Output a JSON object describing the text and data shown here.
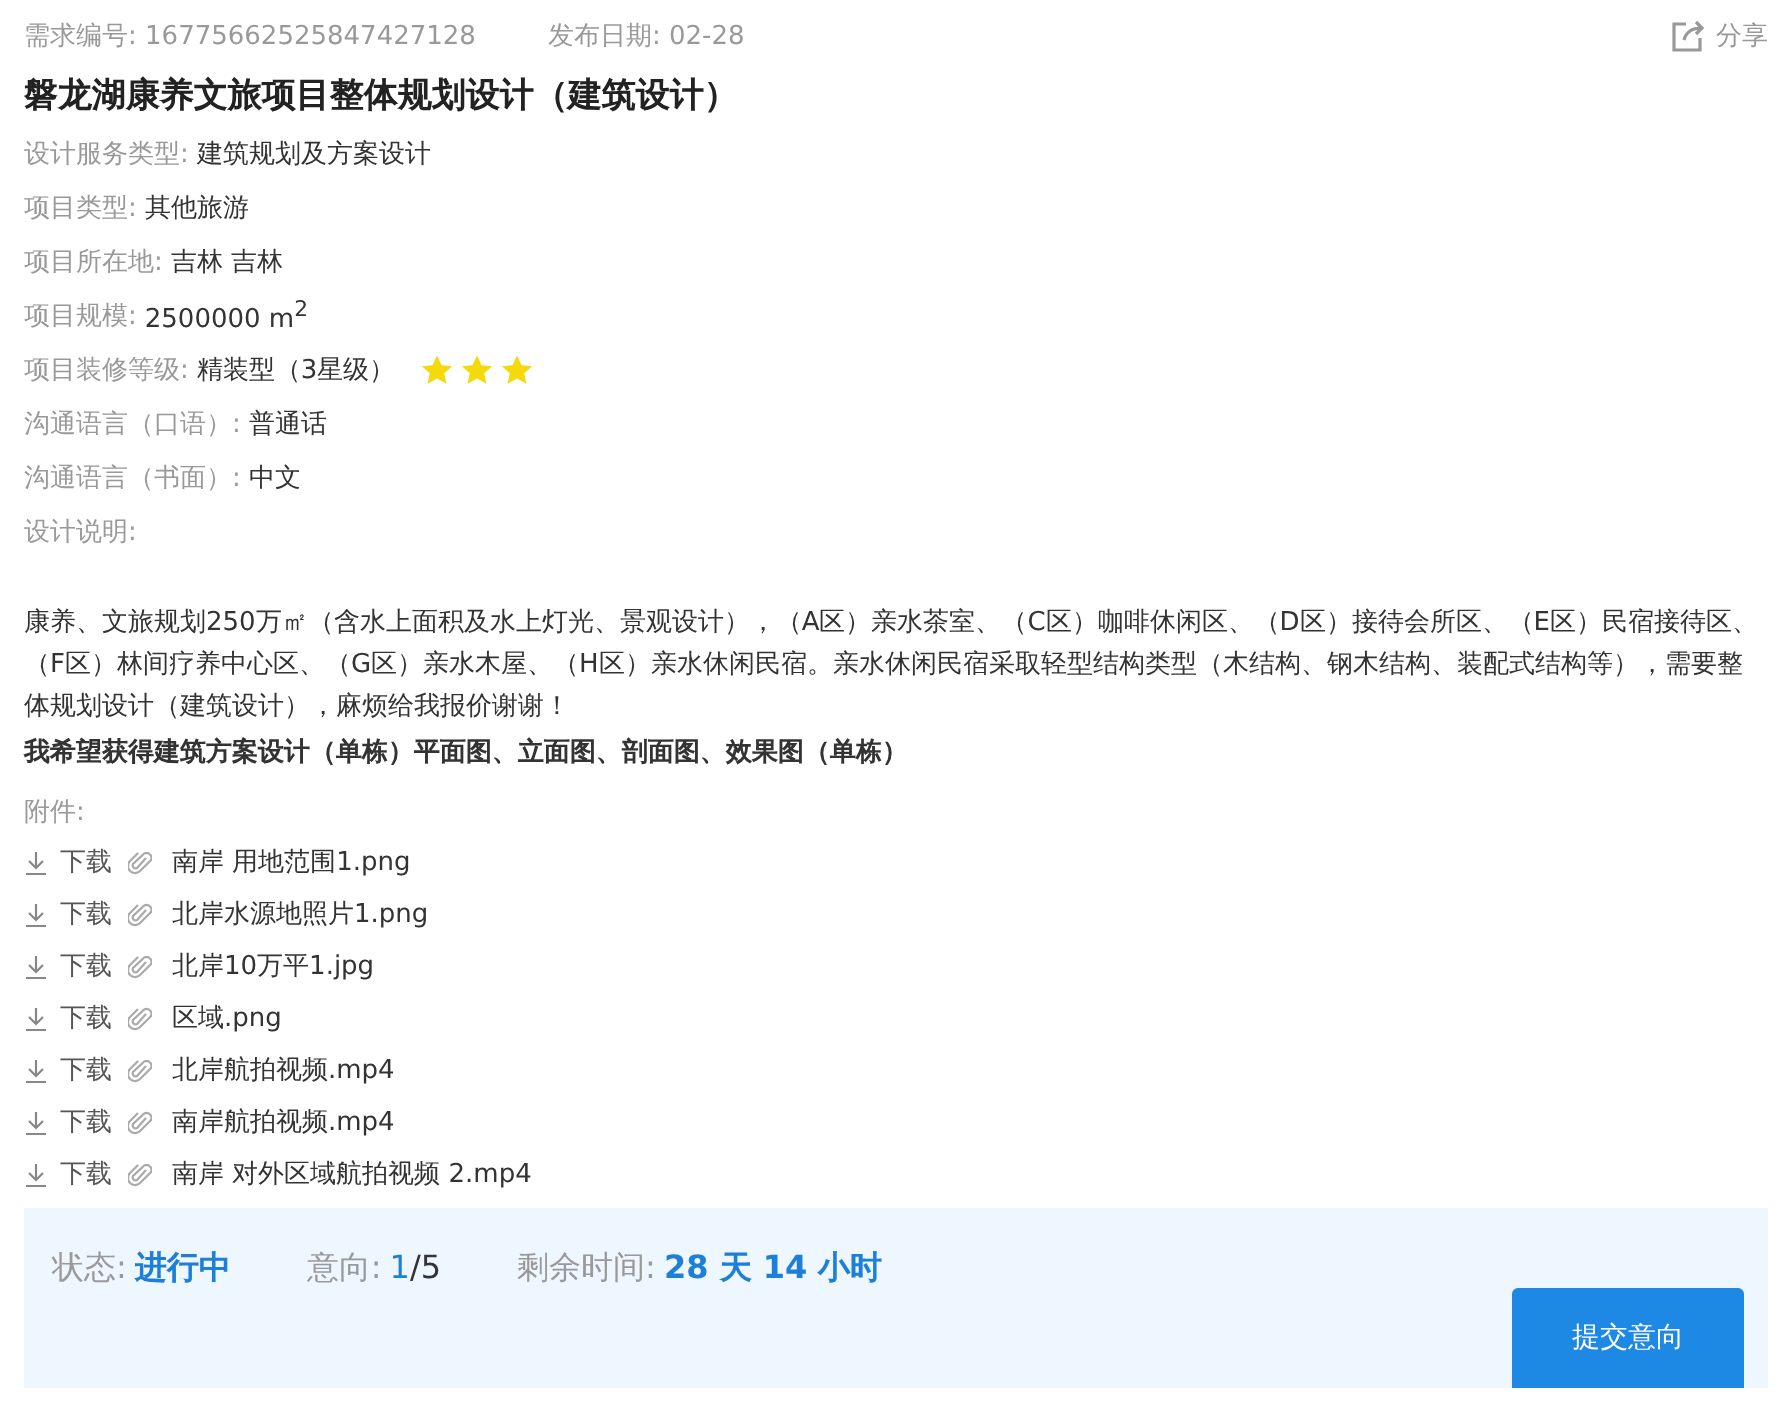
{
  "header": {
    "req_no_label": "需求编号:",
    "req_no": "16775662525847427128",
    "date_label": "发布日期:",
    "date": "02-28",
    "share": "分享"
  },
  "title": "磐龙湖康养文旅项目整体规划设计（建筑设计）",
  "fields": [
    {
      "label": "设计服务类型:",
      "value": "建筑规划及方案设计"
    },
    {
      "label": "项目类型:",
      "value": "其他旅游"
    },
    {
      "label": "项目所在地:",
      "value": "吉林 吉林"
    },
    {
      "label": "项目规模:",
      "value": "2500000 m$^{2}$"
    },
    {
      "label": "项目装修等级:",
      "value": "精装型（3星级）",
      "stars": 3
    },
    {
      "label": "沟通语言（口语）:",
      "value": "普通话"
    },
    {
      "label": "沟通语言（书面）:",
      "value": "中文"
    },
    {
      "label": "设计说明:"
    }
  ],
  "description": "康养、文旅规划250万㎡（含水上面积及水上灯光、景观设计），（A区）亲水茶室、（C区）咖啡休闲区、（D区）接待会所区、（E区）民宿接待区、（F区）林间疗养中心区、（G区）亲水木屋、（H区）亲水休闲民宿。亲水休闲民宿采取轻型结构类型（木结构、钢木结构、装配式结构等），需要整体规划设计（建筑设计），麻烦给我报价谢谢！",
  "wish": "我希望获得建筑方案设计（单栋）平面图、立面图、剖面图、效果图（单栋）",
  "attachments_label": "附件:",
  "attachments": [
    {
      "download": "下载",
      "file": "南岸 用地范围1.png"
    },
    {
      "download": "下载",
      "file": "北岸水源地照片1.png"
    },
    {
      "download": "下载",
      "file": "北岸10万平1.jpg"
    },
    {
      "download": "下载",
      "file": "区域.png"
    },
    {
      "download": "下载",
      "file": "北岸航拍视频.mp4"
    },
    {
      "download": "下载",
      "file": "南岸航拍视频.mp4"
    },
    {
      "download": "下载",
      "file": "南岸 对外区域航拍视频 2.mp4"
    }
  ],
  "footer": {
    "status_label": "状态:",
    "status": "进行中",
    "intent_label": "意向:",
    "intent_current": "1",
    "intent_total": "/5",
    "remaining_label": "剩余时间:",
    "remaining": "28 天 14 小时",
    "submit": "提交意向"
  }
}
